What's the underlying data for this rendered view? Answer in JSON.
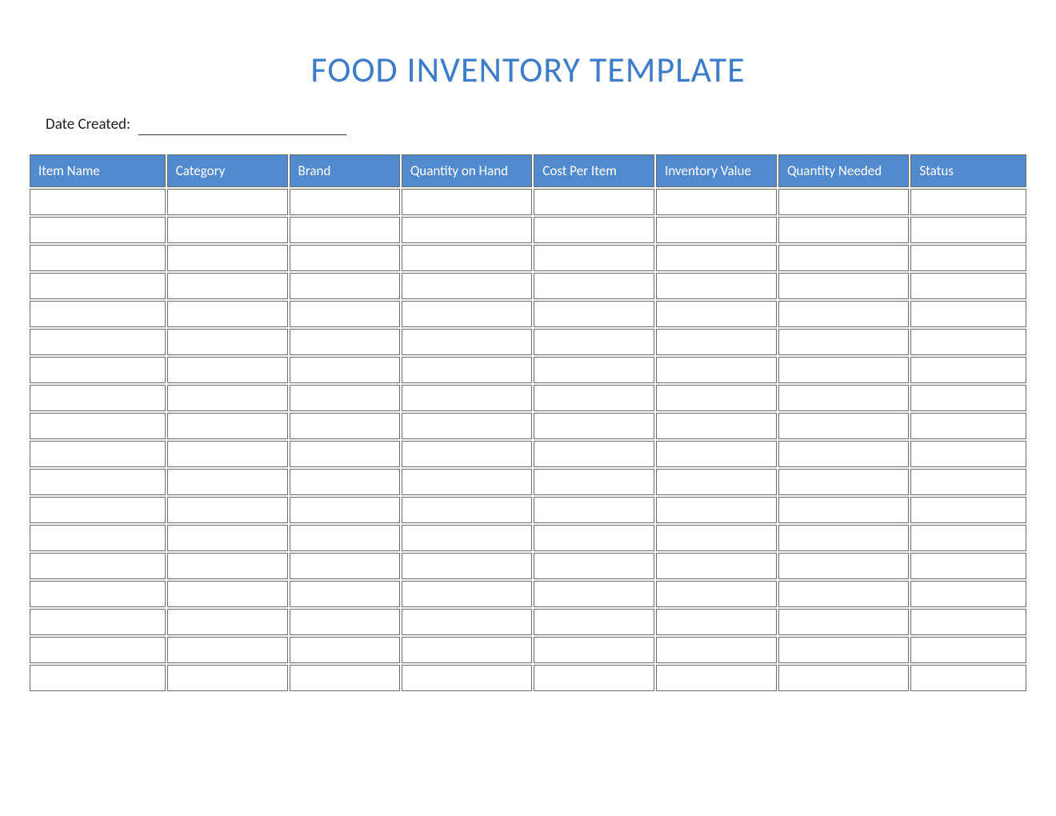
{
  "title": "FOOD INVENTORY TEMPLATE",
  "date_created_label": "Date Created:",
  "date_created_value": "",
  "colors": {
    "accent": "#518bce",
    "title": "#3d7cc9",
    "border": "#6b6b6b"
  },
  "table": {
    "headers": [
      "Item Name",
      "Category",
      "Brand",
      "Quantity on Hand",
      "Cost Per Item",
      "Inventory Value",
      "Quantity Needed",
      "Status"
    ],
    "rows": [
      [
        "",
        "",
        "",
        "",
        "",
        "",
        "",
        ""
      ],
      [
        "",
        "",
        "",
        "",
        "",
        "",
        "",
        ""
      ],
      [
        "",
        "",
        "",
        "",
        "",
        "",
        "",
        ""
      ],
      [
        "",
        "",
        "",
        "",
        "",
        "",
        "",
        ""
      ],
      [
        "",
        "",
        "",
        "",
        "",
        "",
        "",
        ""
      ],
      [
        "",
        "",
        "",
        "",
        "",
        "",
        "",
        ""
      ],
      [
        "",
        "",
        "",
        "",
        "",
        "",
        "",
        ""
      ],
      [
        "",
        "",
        "",
        "",
        "",
        "",
        "",
        ""
      ],
      [
        "",
        "",
        "",
        "",
        "",
        "",
        "",
        ""
      ],
      [
        "",
        "",
        "",
        "",
        "",
        "",
        "",
        ""
      ],
      [
        "",
        "",
        "",
        "",
        "",
        "",
        "",
        ""
      ],
      [
        "",
        "",
        "",
        "",
        "",
        "",
        "",
        ""
      ],
      [
        "",
        "",
        "",
        "",
        "",
        "",
        "",
        ""
      ],
      [
        "",
        "",
        "",
        "",
        "",
        "",
        "",
        ""
      ],
      [
        "",
        "",
        "",
        "",
        "",
        "",
        "",
        ""
      ],
      [
        "",
        "",
        "",
        "",
        "",
        "",
        "",
        ""
      ],
      [
        "",
        "",
        "",
        "",
        "",
        "",
        "",
        ""
      ],
      [
        "",
        "",
        "",
        "",
        "",
        "",
        "",
        ""
      ]
    ]
  }
}
